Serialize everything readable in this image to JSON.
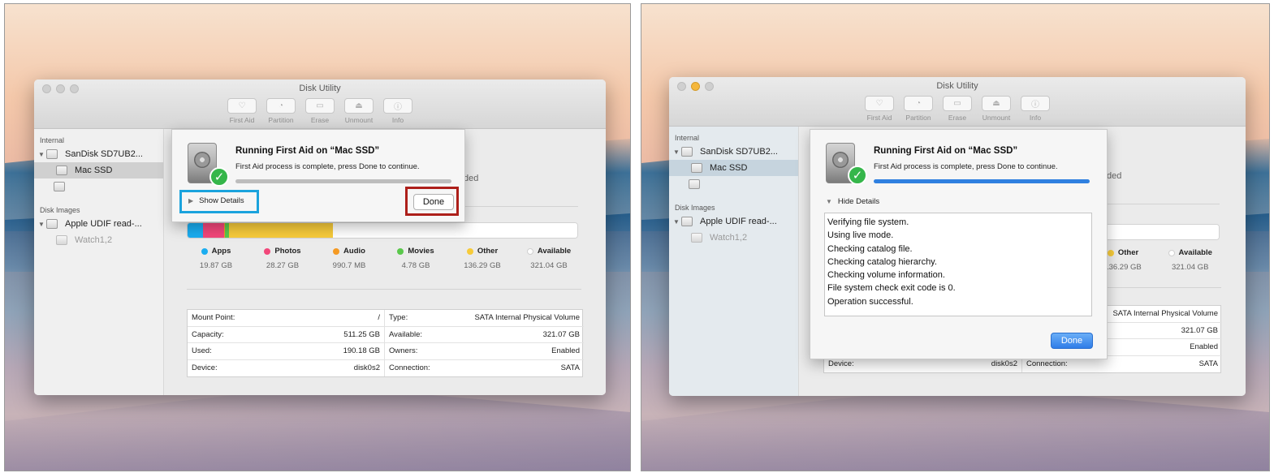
{
  "window": {
    "title": "Disk Utility",
    "toolbar": [
      {
        "label": "First Aid",
        "icon": "stethoscope-icon",
        "glyph": "♡"
      },
      {
        "label": "Partition",
        "icon": "pie-icon",
        "glyph": "◔"
      },
      {
        "label": "Erase",
        "icon": "erase-icon",
        "glyph": "▭"
      },
      {
        "label": "Unmount",
        "icon": "eject-icon",
        "glyph": "⏏"
      },
      {
        "label": "Info",
        "icon": "info-icon",
        "glyph": "ⓘ"
      }
    ]
  },
  "sidebar": {
    "internal_header": "Internal",
    "disk_name": "SanDisk SD7UB2...",
    "volume_name": "Mac SSD",
    "disk_images_header": "Disk Images",
    "image_name": "Apple UDIF read-...",
    "image_volume": "Watch1,2"
  },
  "content": {
    "partial_text": "ded",
    "usage": [
      {
        "name": "Apps",
        "value": "19.87 GB",
        "color": "#1badf0",
        "fraction": 0.0389
      },
      {
        "name": "Photos",
        "value": "28.27 GB",
        "color": "#f2477a",
        "fraction": 0.0553
      },
      {
        "name": "Audio",
        "value": "990.7 MB",
        "color": "#f59a23",
        "fraction": 0.0019
      },
      {
        "name": "Movies",
        "value": "4.78 GB",
        "color": "#5ac84b",
        "fraction": 0.0094
      },
      {
        "name": "Other",
        "value": "136.29 GB",
        "color": "#f7cb3a",
        "fraction": 0.2666
      },
      {
        "name": "Available",
        "value": "321.04 GB",
        "color": "#ffffff",
        "fraction": 0.6279
      }
    ],
    "info_left": [
      {
        "k": "Mount Point:",
        "v": "/"
      },
      {
        "k": "Capacity:",
        "v": "511.25 GB"
      },
      {
        "k": "Used:",
        "v": "190.18 GB"
      },
      {
        "k": "Device:",
        "v": "disk0s2"
      }
    ],
    "info_right": [
      {
        "k": "Type:",
        "v": "SATA Internal Physical Volume"
      },
      {
        "k": "Available:",
        "v": "321.07 GB"
      },
      {
        "k": "Owners:",
        "v": "Enabled"
      },
      {
        "k": "Connection:",
        "v": "SATA"
      }
    ]
  },
  "sheet": {
    "title": "Running First Aid on “Mac SSD”",
    "message": "First Aid process is complete, press Done to continue.",
    "show_details": "Show Details",
    "hide_details": "Hide Details",
    "done": "Done",
    "progress": 1.0,
    "log": [
      "Verifying file system.",
      "Using live mode.",
      "Checking catalog file.",
      "Checking catalog hierarchy.",
      "Checking volume information.",
      "File system check exit code is 0.",
      "Operation successful."
    ]
  },
  "colors": {
    "highlight_blue": "#1ba3dd",
    "highlight_red": "#ad1f1a",
    "accent": "#2f7de8"
  }
}
